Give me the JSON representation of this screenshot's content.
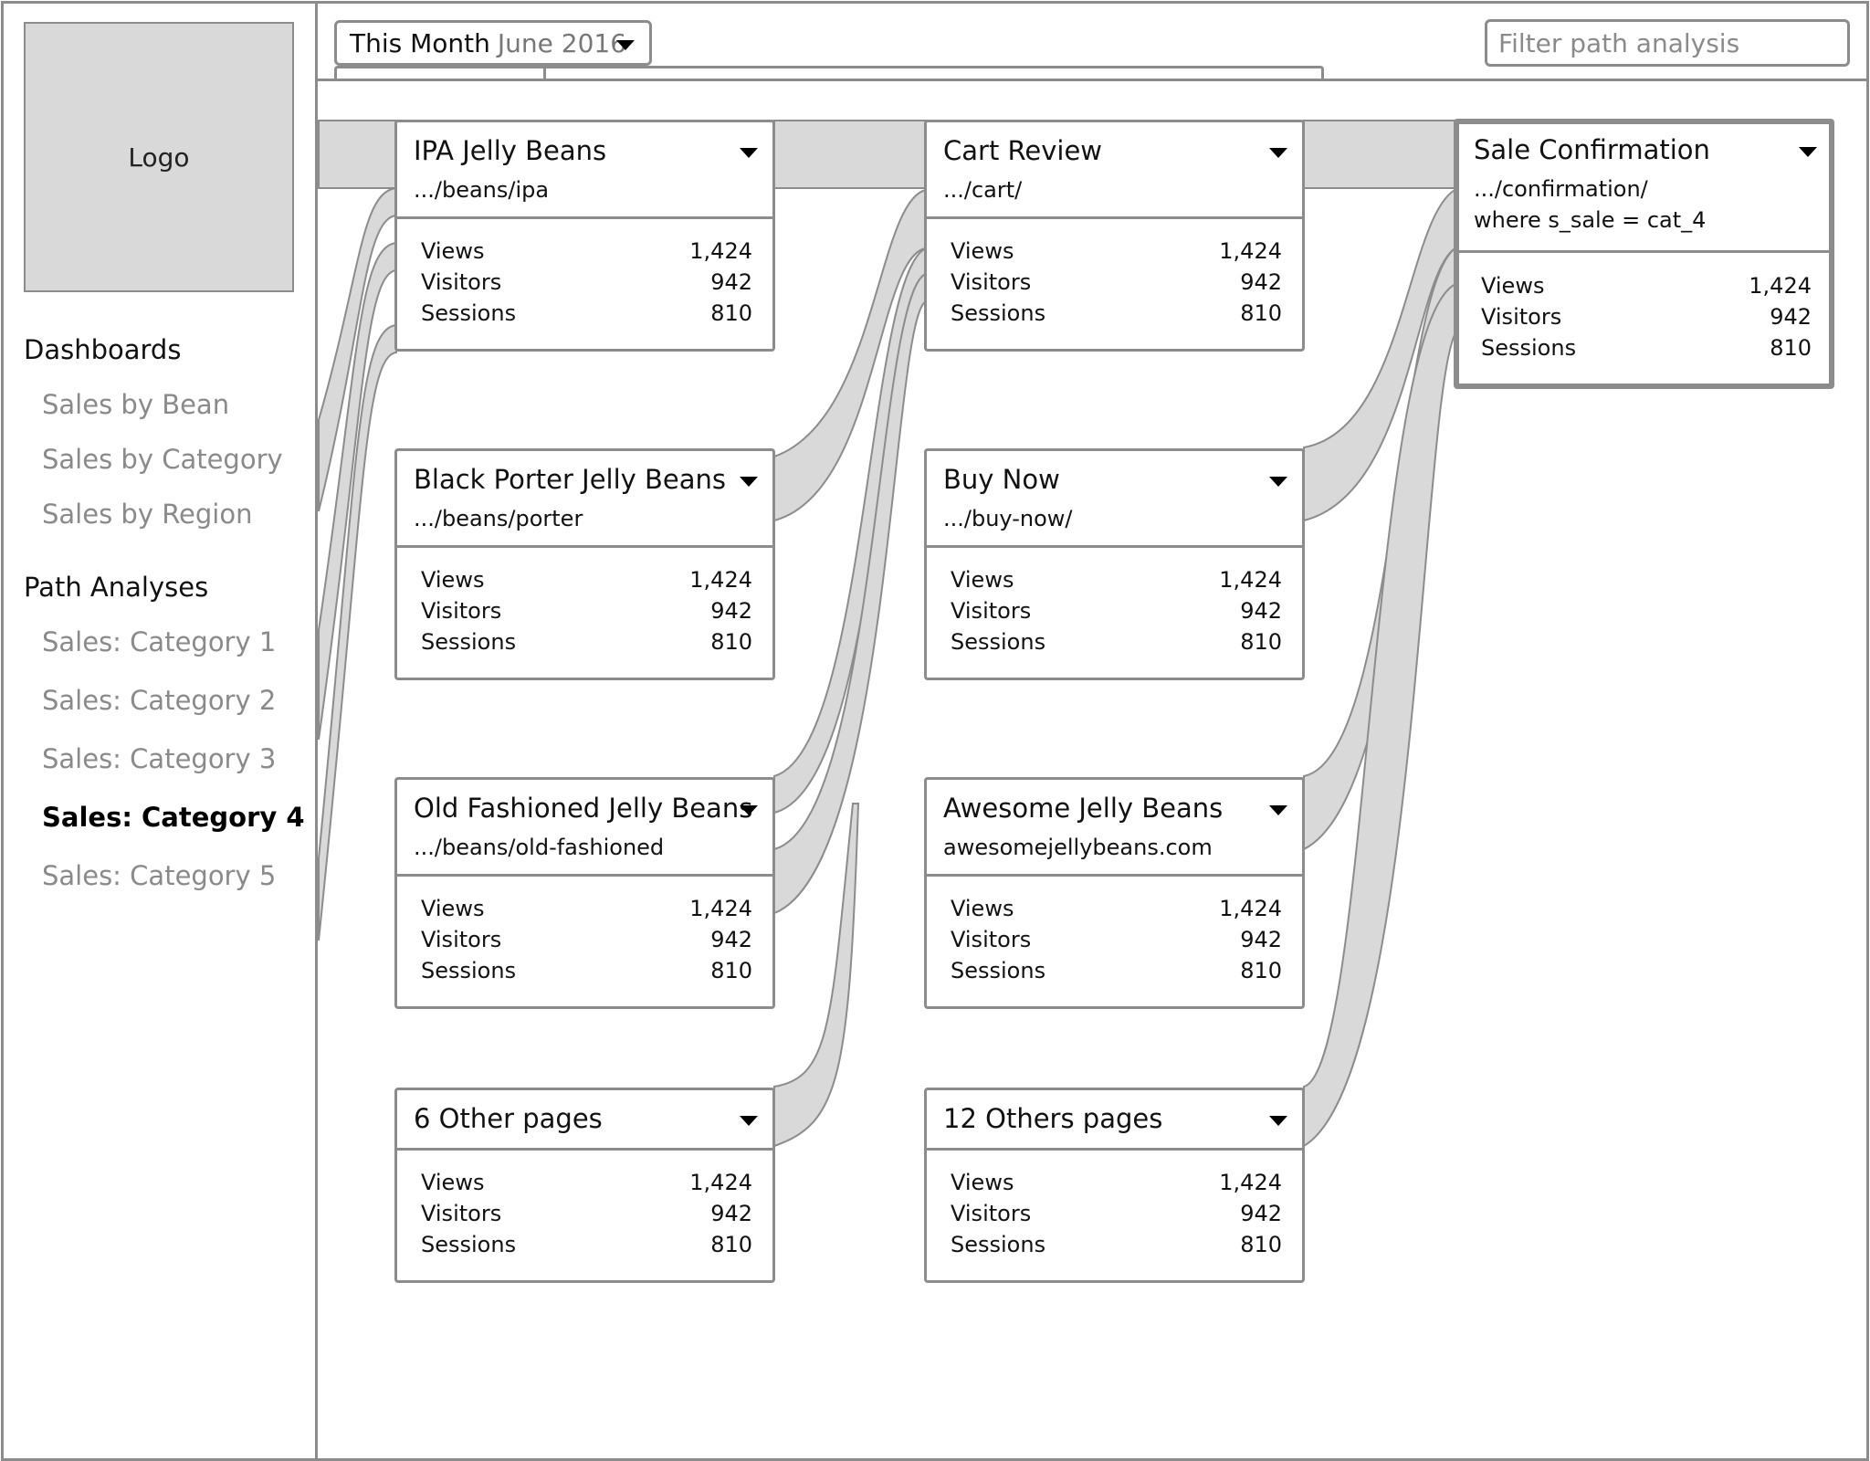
{
  "sidebar": {
    "logo": "Logo",
    "dashboards_heading": "Dashboards",
    "dashboards": [
      "Sales by Bean",
      "Sales by Category",
      "Sales by Region"
    ],
    "path_heading": "Path Analyses",
    "paths": [
      "Sales: Category 1",
      "Sales: Category 2",
      "Sales: Category 3",
      "Sales: Category 4",
      "Sales: Category 5"
    ],
    "active_path": "Sales: Category 4"
  },
  "toolbar": {
    "period": "This Month",
    "period_value": "June 2016",
    "filter_placeholder": "Filter path analysis"
  },
  "metric_labels": {
    "views": "Views",
    "visitors": "Visitors",
    "sessions": "Sessions"
  },
  "columns": [
    {
      "nodes": [
        {
          "title": "IPA Jelly Beans",
          "url": ".../beans/ipa",
          "views": "1,424",
          "visitors": "942",
          "sessions": "810"
        },
        {
          "title": "Black Porter Jelly Beans",
          "url": ".../beans/porter",
          "views": "1,424",
          "visitors": "942",
          "sessions": "810"
        },
        {
          "title": "Old Fashioned Jelly Beans",
          "url": ".../beans/old-fashioned",
          "views": "1,424",
          "visitors": "942",
          "sessions": "810"
        },
        {
          "title": "6 Other pages",
          "views": "1,424",
          "visitors": "942",
          "sessions": "810"
        }
      ]
    },
    {
      "nodes": [
        {
          "title": "Cart Review",
          "url": ".../cart/",
          "views": "1,424",
          "visitors": "942",
          "sessions": "810"
        },
        {
          "title": "Buy Now",
          "url": ".../buy-now/",
          "views": "1,424",
          "visitors": "942",
          "sessions": "810"
        },
        {
          "title": "Awesome Jelly Beans",
          "url": "awesomejellybeans.com",
          "views": "1,424",
          "visitors": "942",
          "sessions": "810"
        },
        {
          "title": "12 Others pages",
          "views": "1,424",
          "visitors": "942",
          "sessions": "810"
        }
      ]
    },
    {
      "nodes": [
        {
          "title": "Sale Confirmation",
          "url": ".../confirmation/",
          "url_line2": "where s_sale = cat_4",
          "views": "1,424",
          "visitors": "942",
          "sessions": "810",
          "selected": true
        }
      ]
    }
  ],
  "colors": {
    "border": "#8c8c8c",
    "flow_fill": "#d9d9d9",
    "muted_text": "#8a8a8a"
  }
}
